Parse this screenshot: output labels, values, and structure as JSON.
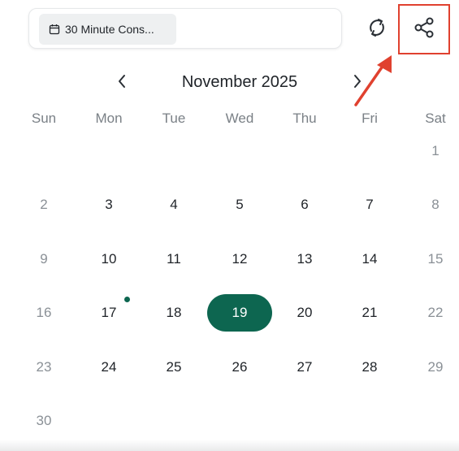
{
  "event": {
    "label": "30 Minute Cons..."
  },
  "calendar": {
    "month_title": "November 2025",
    "weekdays": [
      "Sun",
      "Mon",
      "Tue",
      "Wed",
      "Thu",
      "Fri",
      "Sat"
    ],
    "selected_day": "19",
    "weeks": [
      [
        "",
        "",
        "",
        "",
        "",
        "",
        "1"
      ],
      [
        "2",
        "3",
        "4",
        "5",
        "6",
        "7",
        "8"
      ],
      [
        "9",
        "10",
        "11",
        "12",
        "13",
        "14",
        "15"
      ],
      [
        "16",
        "17",
        "18",
        "19",
        "20",
        "21",
        "22"
      ],
      [
        "23",
        "24",
        "25",
        "26",
        "27",
        "28",
        "29"
      ],
      [
        "30",
        "",
        "",
        "",
        "",
        "",
        ""
      ]
    ]
  },
  "colors": {
    "accent": "#0d6650",
    "annotation": "#e0412f"
  },
  "icons": [
    "calendar-icon",
    "refresh-icon",
    "share-icon",
    "chevron-left-icon",
    "chevron-right-icon",
    "annotation-arrow-icon"
  ]
}
